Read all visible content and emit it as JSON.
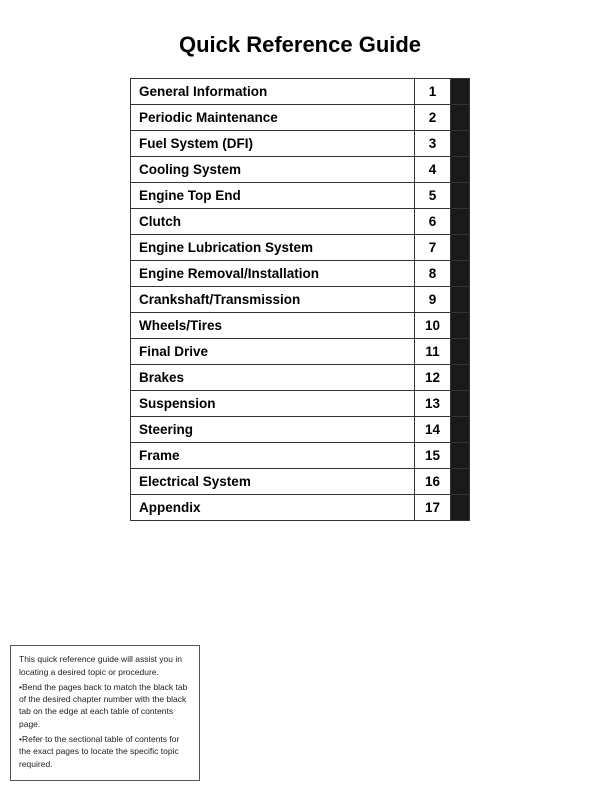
{
  "title": "Quick Reference Guide",
  "items": [
    {
      "label": "General Information",
      "number": "1"
    },
    {
      "label": "Periodic Maintenance",
      "number": "2"
    },
    {
      "label": "Fuel System (DFI)",
      "number": "3"
    },
    {
      "label": "Cooling System",
      "number": "4"
    },
    {
      "label": "Engine Top End",
      "number": "5"
    },
    {
      "label": "Clutch",
      "number": "6"
    },
    {
      "label": "Engine Lubrication System",
      "number": "7"
    },
    {
      "label": "Engine Removal/Installation",
      "number": "8"
    },
    {
      "label": "Crankshaft/Transmission",
      "number": "9"
    },
    {
      "label": "Wheels/Tires",
      "number": "10"
    },
    {
      "label": "Final Drive",
      "number": "11"
    },
    {
      "label": "Brakes",
      "number": "12"
    },
    {
      "label": "Suspension",
      "number": "13"
    },
    {
      "label": "Steering",
      "number": "14"
    },
    {
      "label": "Frame",
      "number": "15"
    },
    {
      "label": "Electrical System",
      "number": "16"
    },
    {
      "label": "Appendix",
      "number": "17"
    }
  ],
  "footer": {
    "line1": "This quick reference guide will assist you in locating a desired topic or procedure.",
    "line2": "•Bend the pages back to match the black tab of the desired chapter number with the black tab on the edge at each table of contents page.",
    "line3": "•Refer to the sectional table of contents for the exact pages to locate the specific topic required."
  }
}
